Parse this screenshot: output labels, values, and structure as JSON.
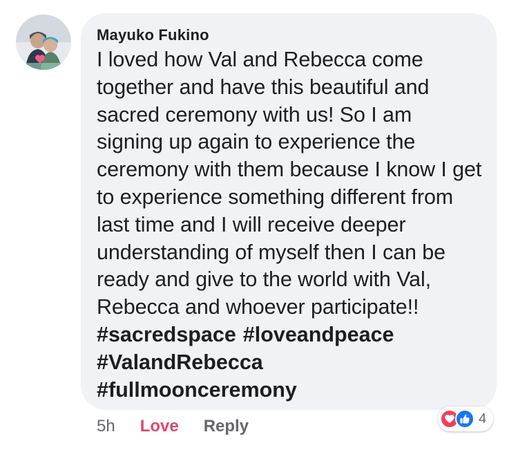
{
  "comment": {
    "author": "Mayuko Fukino",
    "body": "I loved how Val and Rebecca come together and have this beautiful and sacred ceremony with us!  So I am signing up again to experience the ceremony with them because I know I get to experience something different from last time and I will receive deeper understanding of myself then I can be ready and give to the world with Val, Rebecca and whoever participate!!",
    "hashtags": [
      "#sacredspace",
      "#loveandpeace",
      "#ValandRebecca",
      "#fullmoonceremony"
    ]
  },
  "actions": {
    "time": "5h",
    "love_label": "Love",
    "reply_label": "Reply"
  },
  "reactions": {
    "icons": [
      "heart-icon",
      "thumbs-up-icon"
    ],
    "count": "4"
  },
  "colors": {
    "bubble": "#f0f2f5",
    "love": "#e0476a",
    "like": "#1877f2",
    "heart": "#f33e58",
    "muted": "#65676b"
  }
}
